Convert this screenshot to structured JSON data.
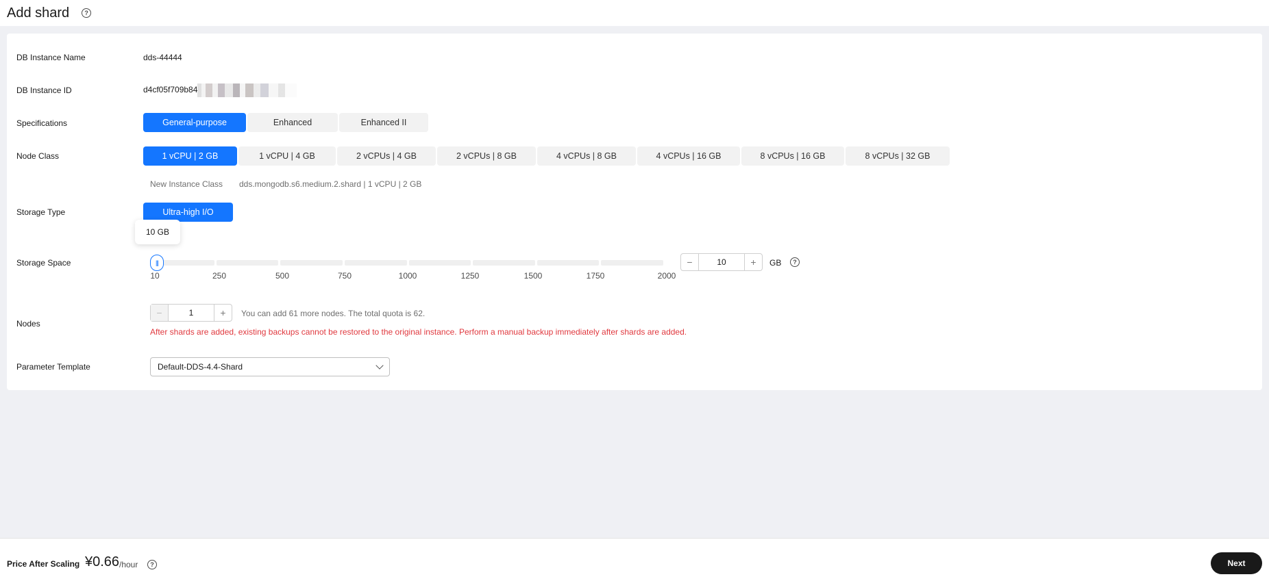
{
  "header": {
    "title": "Add shard",
    "help_icon": "question-circle-icon"
  },
  "form": {
    "instance_name": {
      "label": "DB Instance Name",
      "value": "dds-44444"
    },
    "instance_id": {
      "label": "DB Instance ID",
      "value": "d4cf05f709b84"
    },
    "specifications": {
      "label": "Specifications",
      "options": [
        "General-purpose",
        "Enhanced",
        "Enhanced II"
      ],
      "selected": "General-purpose"
    },
    "node_class": {
      "label": "Node Class",
      "options": [
        "1 vCPU | 2 GB",
        "1 vCPU | 4 GB",
        "2 vCPUs | 4 GB",
        "2 vCPUs | 8 GB",
        "4 vCPUs | 8 GB",
        "4 vCPUs | 16 GB",
        "8 vCPUs | 16 GB",
        "8 vCPUs | 32 GB"
      ],
      "selected": "1 vCPU | 2 GB",
      "new_class_label": "New Instance Class",
      "new_class_value": "dds.mongodb.s6.medium.2.shard | 1 vCPU | 2 GB"
    },
    "storage_type": {
      "label": "Storage Type",
      "options": [
        "Ultra-high I/O"
      ],
      "selected": "Ultra-high I/O"
    },
    "storage_space": {
      "label": "Storage Space",
      "tooltip": "10 GB",
      "ticks": [
        "10",
        "250",
        "500",
        "750",
        "1000",
        "1250",
        "1500",
        "1750",
        "2000"
      ],
      "value": "10",
      "unit": "GB",
      "minus": "−",
      "plus": "+"
    },
    "nodes": {
      "label": "Nodes",
      "value": "1",
      "minus": "−",
      "plus": "+",
      "quota_text": "You can add 61 more nodes. The total quota is 62.",
      "warning": "After shards are added, existing backups cannot be restored to the original instance. Perform a manual backup immediately after shards are added."
    },
    "parameter_template": {
      "label": "Parameter Template",
      "value": "Default-DDS-4.4-Shard"
    }
  },
  "footer": {
    "price_label": "Price After Scaling",
    "price_value": "¥0.66",
    "price_unit": "/hour",
    "next_label": "Next"
  },
  "colors": {
    "accent": "#1476ff",
    "warning": "#e0383e",
    "background": "#eff0f4"
  }
}
